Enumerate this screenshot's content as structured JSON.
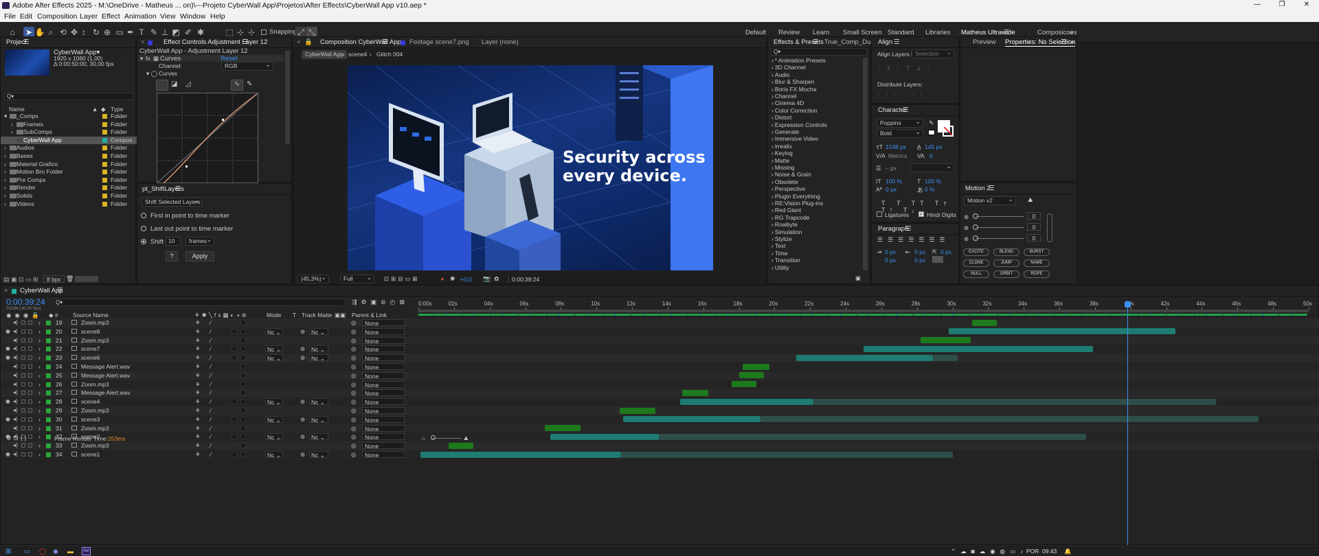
{
  "titlebar": {
    "title": "Adobe After Effects 2025 - M:\\OneDrive - Matheus ... on)\\---Projeto CyberWall App\\Projetos\\After Effects\\CyberWall App v10.aep *"
  },
  "menu": [
    "File",
    "Edit",
    "Composition",
    "Layer",
    "Effect",
    "Animation",
    "View",
    "Window",
    "Help"
  ],
  "toolbar": {
    "snapping": "Snapping"
  },
  "workspaces": [
    "Default",
    "Review",
    "Learn",
    "Small Screen",
    "Standard",
    "Libraries",
    "Matheus Ultrawide",
    "Composicoes"
  ],
  "project": {
    "title": "Project",
    "comp_name": "CyberWall App▾",
    "comp_info1": "1920 x 1080 (1,00)",
    "comp_info2": "Δ 0:00:50:00, 30,00 fps",
    "search_placeholder": "Q▾",
    "col_name": "Name",
    "col_type": "Type",
    "items": [
      {
        "name": "_Comps",
        "type": "Folder",
        "indent": 0,
        "open": true
      },
      {
        "name": "Frames",
        "type": "Folder",
        "indent": 1,
        "open": false
      },
      {
        "name": "SubComps",
        "type": "Folder",
        "indent": 1,
        "open": false
      },
      {
        "name": "CyberWall App",
        "type": "Compos",
        "indent": 1,
        "open": null
      },
      {
        "name": "Audios",
        "type": "Folder",
        "indent": 0,
        "open": false
      },
      {
        "name": "Bases",
        "type": "Folder",
        "indent": 0,
        "open": false
      },
      {
        "name": "Material Grafico",
        "type": "Folder",
        "indent": 0,
        "open": false
      },
      {
        "name": "Motion Bro Folder",
        "type": "Folder",
        "indent": 0,
        "open": false
      },
      {
        "name": "Pre Comps",
        "type": "Folder",
        "indent": 0,
        "open": false
      },
      {
        "name": "Render",
        "type": "Folder",
        "indent": 0,
        "open": false
      },
      {
        "name": "Solids",
        "type": "Folder",
        "indent": 0,
        "open": false
      },
      {
        "name": "Videos",
        "type": "Folder",
        "indent": 0,
        "open": false
      }
    ],
    "bpc": "8 bpc"
  },
  "effect_controls": {
    "title": "Effect Controls Adjustment Layer 12",
    "subtitle": "CyberWall App - Adjustment Layer 12",
    "fx_name": "Curves",
    "reset": "Reset",
    "channel_label": "Channel:",
    "channel_value": "RGB",
    "curves_label": "Curves"
  },
  "shift_layers": {
    "title": "pt_ShiftLayers",
    "mode": "Shift Selected Layers",
    "opt1": "First in point to time marker",
    "opt2": "Last out point to time marker",
    "opt3": "Shift",
    "shift_value": "10",
    "shift_unit": "frames",
    "help": "?",
    "apply": "Apply"
  },
  "composition": {
    "tab": "Composition CyberWall App",
    "footage_tab": "Footage scene7.png",
    "layer_tab": "Layer (none)",
    "crumbs": [
      "CyberWall App",
      "scene4",
      "Glitch 004"
    ],
    "headline1": "Security across",
    "headline2": "every device.",
    "zoom": "(45,3%)",
    "quality": "Full",
    "exposure": "+0,0",
    "timecode": "0:00:39:24"
  },
  "effects_presets": {
    "title": "Effects & Presets",
    "tab2": "True_Comp_Dupl",
    "search": "Q▾",
    "items": [
      "* Animation Presets",
      "3D Channel",
      "Audio",
      "Blur & Sharpen",
      "Boris FX Mocha",
      "Channel",
      "Cinema 4D",
      "Color Correction",
      "Distort",
      "Expression Controls",
      "Generate",
      "Immersive Video",
      "irrealix",
      "Keying",
      "Matte",
      "Missing",
      "Noise & Grain",
      "Obsolete",
      "Perspective",
      "Plugin Everything",
      "RE:Vision Plug-ins",
      "Red Giant",
      "RG Trapcode",
      "Rowbyte",
      "Simulation",
      "Stylize",
      "Text",
      "Time",
      "Transition",
      "Utility"
    ]
  },
  "align": {
    "title": "Align",
    "align_to_label": "Align Layers to:",
    "align_to_value": "Selection",
    "distribute": "Distribute Layers:"
  },
  "character": {
    "title": "Character",
    "font": "Poppins",
    "style": "Bold",
    "size": "1038 px",
    "leading": "145 px",
    "kerning": "Metrics",
    "tracking": "0",
    "stroke": "– px",
    "vscale": "100 %",
    "hscale": "100 %",
    "baseline": "0 px",
    "tsume": "0 %",
    "ligatures": "Ligatures",
    "hindi": "Hindi Digits"
  },
  "paragraph": {
    "title": "Paragraph",
    "v1": "0 px",
    "v2": "0 px",
    "v3": "0 px",
    "v4": "0 px",
    "v5": "0 px"
  },
  "right_panel": {
    "preview": "Preview",
    "properties": "Properties: No Selection"
  },
  "motion": {
    "title": "Motion 2",
    "version": "Motion v2",
    "sliders": [
      "0",
      "0",
      "0"
    ],
    "buttons": [
      "EXCITE",
      "BLEND",
      "BURST",
      "CLONE",
      "JUMP",
      "NAME",
      "NULL",
      "ORBIT",
      "ROPE"
    ]
  },
  "timeline": {
    "comp_tab": "CyberWall App",
    "timecode": "0:00:39:24",
    "frame_info": "01194 (30.00 fps)",
    "search": "Q▾",
    "col_source": "Source Name",
    "col_mode": "Mode",
    "col_t": "T",
    "col_track": "Track Matte",
    "col_parent": "Parent & Link",
    "ruler": [
      "0:00s",
      "02s",
      "04s",
      "06s",
      "08s",
      "10s",
      "12s",
      "14s",
      "16s",
      "18s",
      "20s",
      "22s",
      "24s",
      "26s",
      "28s",
      "30s",
      "32s",
      "34s",
      "36s",
      "38s",
      "40s",
      "42s",
      "44s",
      "46s",
      "48s",
      "50s"
    ],
    "render_time_label": "Frame Render Time:",
    "render_time_value": "253ms",
    "playhead_sec": 39.8,
    "duration_sec": 50,
    "layers": [
      {
        "num": "19",
        "name": "Zoom.mp3",
        "type": "audio",
        "color": "#2aa83a",
        "video": false,
        "mode": "",
        "parent": "None",
        "in": 31.1,
        "out": 32.5,
        "seg": null
      },
      {
        "num": "20",
        "name": "scene8",
        "type": "video",
        "color": "#2aa83a",
        "video": true,
        "mode": "Nc",
        "parent": "None",
        "in": 29.8,
        "out": 42.5,
        "seg": 42.5
      },
      {
        "num": "21",
        "name": "Zoom.mp3",
        "type": "audio",
        "color": "#2aa83a",
        "video": false,
        "mode": "",
        "parent": "None",
        "in": 28.2,
        "out": 31.0,
        "seg": null
      },
      {
        "num": "22",
        "name": "scene7",
        "type": "video",
        "color": "#2aa83a",
        "video": true,
        "mode": "Nc",
        "parent": "None",
        "in": 25.0,
        "out": 37.9,
        "seg": 37.9
      },
      {
        "num": "23",
        "name": "scene6",
        "type": "video",
        "color": "#2aa83a",
        "video": true,
        "mode": "Nc",
        "parent": "None",
        "in": 21.2,
        "out": 28.9,
        "seg": 30.3
      },
      {
        "num": "24",
        "name": "Message Alert.wav",
        "type": "audio",
        "color": "#2aa83a",
        "video": false,
        "mode": "",
        "parent": "None",
        "in": 18.2,
        "out": 19.7,
        "seg": null
      },
      {
        "num": "25",
        "name": "Message Alert.wav",
        "type": "audio",
        "color": "#2aa83a",
        "video": false,
        "mode": "",
        "parent": "None",
        "in": 18.0,
        "out": 19.4,
        "seg": null
      },
      {
        "num": "26",
        "name": "Zoom.mp3",
        "type": "audio",
        "color": "#2aa83a",
        "video": false,
        "mode": "",
        "parent": "None",
        "in": 17.6,
        "out": 19.0,
        "seg": null
      },
      {
        "num": "27",
        "name": "Message Alert.wav",
        "type": "audio",
        "color": "#2aa83a",
        "video": false,
        "mode": "",
        "parent": "None",
        "in": 14.8,
        "out": 16.3,
        "seg": null
      },
      {
        "num": "28",
        "name": "scene4",
        "type": "video",
        "color": "#2aa83a",
        "video": true,
        "mode": "Nc",
        "parent": "None",
        "in": 14.7,
        "out": 22.2,
        "seg": 44.8
      },
      {
        "num": "29",
        "name": "Zoom.mp3",
        "type": "audio",
        "color": "#2aa83a",
        "video": false,
        "mode": "",
        "parent": "None",
        "in": 11.3,
        "out": 13.3,
        "seg": null
      },
      {
        "num": "30",
        "name": "scene3",
        "type": "video",
        "color": "#2aa83a",
        "video": true,
        "mode": "Nc",
        "parent": "None",
        "in": 11.5,
        "out": 19.2,
        "seg": 47.2
      },
      {
        "num": "31",
        "name": "Zoom.mp3",
        "type": "audio",
        "color": "#2aa83a",
        "video": false,
        "mode": "",
        "parent": "None",
        "in": 7.1,
        "out": 9.1,
        "seg": null
      },
      {
        "num": "32",
        "name": "scene2",
        "type": "video",
        "color": "#2aa83a",
        "video": true,
        "mode": "Nc",
        "parent": "None",
        "in": 7.4,
        "out": 13.5,
        "seg": 37.5
      },
      {
        "num": "33",
        "name": "Zoom.mp3",
        "type": "audio",
        "color": "#2aa83a",
        "video": false,
        "mode": "",
        "parent": "None",
        "in": 1.7,
        "out": 3.1,
        "seg": null
      },
      {
        "num": "34",
        "name": "scene1",
        "type": "video",
        "color": "#2aa83a",
        "video": true,
        "mode": "Nc",
        "parent": "None",
        "in": 0.1,
        "out": 11.4,
        "seg": 30.0
      }
    ]
  },
  "taskbar": {
    "lang": "POR",
    "time": "09:43"
  }
}
